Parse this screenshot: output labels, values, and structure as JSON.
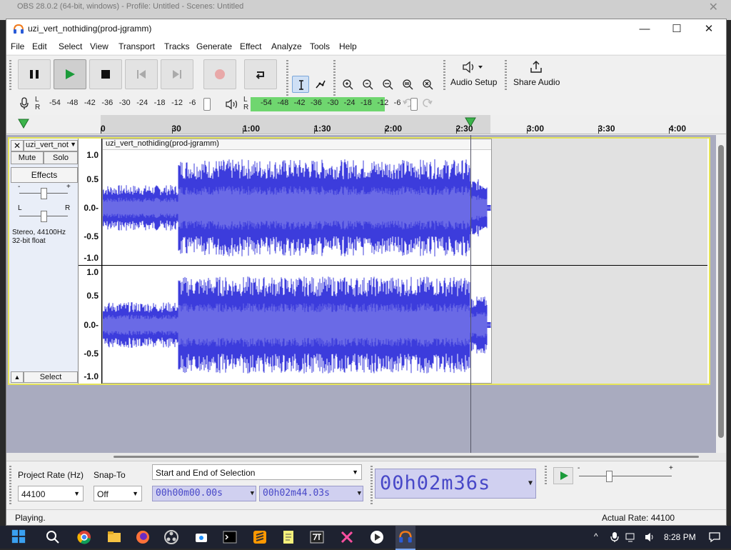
{
  "background_window": {
    "title": "OBS 28.0.2 (64-bit, windows) - Profile: Untitled - Scenes: Untitled"
  },
  "window": {
    "title": "uzi_vert_nothiding(prod-jgramm)"
  },
  "menu": [
    "File",
    "Edit",
    "Select",
    "View",
    "Transport",
    "Tracks",
    "Generate",
    "Effect",
    "Analyze",
    "Tools",
    "Help"
  ],
  "toolbar": {
    "audio_setup": "Audio Setup",
    "share_audio": "Share Audio"
  },
  "meters": {
    "record_scale": [
      "-54",
      "-48",
      "-42",
      "-36",
      "-30",
      "-24",
      "-18",
      "-12",
      "-6"
    ],
    "play_scale": [
      "-54",
      "-48",
      "-42",
      "-36",
      "-30",
      "-24",
      "-18",
      "-12",
      "-6"
    ],
    "lr": [
      "L",
      "R"
    ],
    "play_level": 0.57
  },
  "timeline": {
    "ticks": [
      "0",
      "30",
      "1:00",
      "1:30",
      "2:00",
      "2:30",
      "3:00",
      "3:30",
      "4:00"
    ]
  },
  "track": {
    "name": "uzi_vert_not",
    "clip_name": "uzi_vert_nothiding(prod-jgramm)",
    "mute": "Mute",
    "solo": "Solo",
    "effects": "Effects",
    "gain_minus": "-",
    "gain_plus": "+",
    "pan_l": "L",
    "pan_r": "R",
    "info1": "Stereo, 44100Hz",
    "info2": "32-bit float",
    "select": "Select",
    "ruler": [
      "1.0",
      "0.5",
      "0.0-",
      "-0.5",
      "-1.0"
    ],
    "ruler2": [
      "1.0",
      "0.5",
      "0.0-",
      "-0.5",
      "-1.0"
    ]
  },
  "bottom": {
    "project_rate_label": "Project Rate (Hz)",
    "project_rate": "44100",
    "snap_label": "Snap-To",
    "snap": "Off",
    "selection_mode": "Start and End of Selection",
    "sel_start": "00h00m00.00s",
    "sel_end": "00h02m44.03s",
    "time": "00h02m36s"
  },
  "status": {
    "left": "Playing.",
    "right": "Actual Rate: 44100"
  },
  "taskbar": {
    "clock": "8:28 PM"
  },
  "colors": {
    "waveform": "#3c3cdc",
    "waveform_rms": "#6a6ae6",
    "selection_border": "#e6e45a",
    "meter_green": "#6fd66f",
    "time_text": "#4848c8"
  }
}
